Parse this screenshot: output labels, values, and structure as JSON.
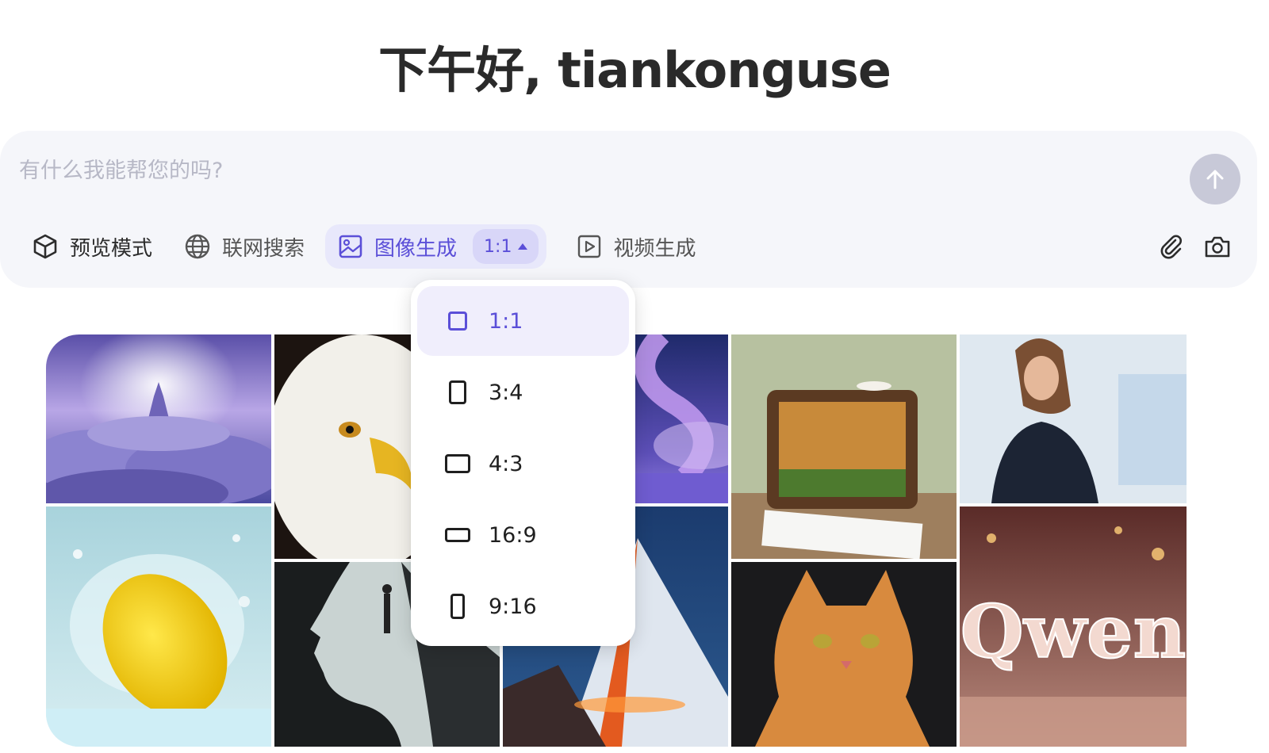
{
  "greeting": "下午好, tiankonguse",
  "composer": {
    "placeholder": "有什么我能帮您的吗?",
    "send_icon": "arrow-up-icon"
  },
  "toolbar": {
    "preview_mode": {
      "label": "预览模式",
      "icon": "cube-icon"
    },
    "web_search": {
      "label": "联网搜索",
      "icon": "globe-icon"
    },
    "image_gen": {
      "label": "图像生成",
      "icon": "image-icon",
      "ratio": "1:1"
    },
    "video_gen": {
      "label": "视频生成",
      "icon": "play-square-icon"
    },
    "attach_icon": "paperclip-icon",
    "camera_icon": "camera-icon"
  },
  "ratio_menu": {
    "selected": "1:1",
    "items": [
      {
        "label": "1:1"
      },
      {
        "label": "3:4"
      },
      {
        "label": "4:3"
      },
      {
        "label": "16:9"
      },
      {
        "label": "9:16"
      }
    ]
  },
  "gallery": {
    "images": [
      "castle-in-clouds",
      "eagle",
      "lemon-splash",
      "silhouette-profile",
      "purple-wave",
      "volcano-mountains",
      "radio-diorama",
      "ginger-cat",
      "smiling-woman-speaker",
      "glowing-qwen-text"
    ],
    "qwen_text": "Qwen"
  },
  "colors": {
    "accent": "#5b4fd8",
    "accent_bg": "#e8e8fb",
    "composer_bg": "#f5f6fa",
    "send_button": "#c8c9d8"
  }
}
